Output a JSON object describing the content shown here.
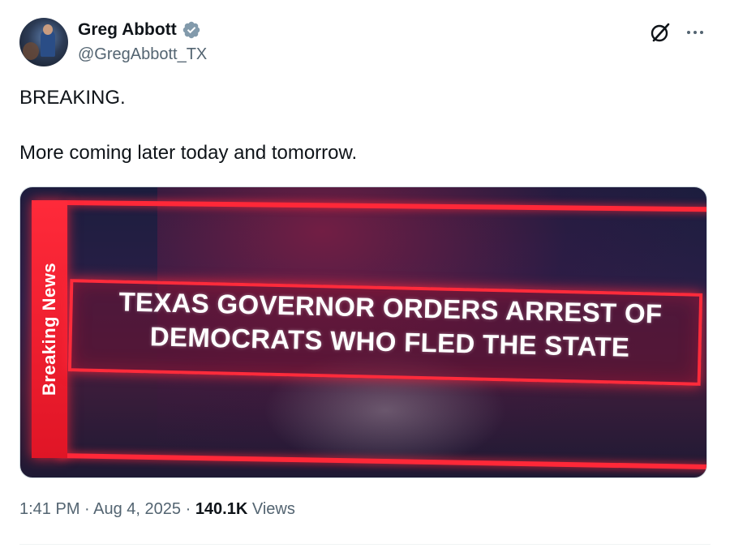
{
  "author": {
    "name": "Greg Abbott",
    "handle": "@GregAbbott_TX",
    "avatar_icon": "profile-photo",
    "verified_icon": "verified-badge-icon",
    "verified_color": "#829aab"
  },
  "header_actions": {
    "grok_icon": "grok-icon",
    "more_icon": "more-options-icon"
  },
  "tweet": {
    "text_line1": "BREAKING.",
    "text_line2": "More coming later today and tomorrow."
  },
  "media": {
    "side_label": "Breaking News",
    "headline_line1": "TEXAS GOVERNOR ORDERS ARREST OF",
    "headline_line2": "DEMOCRATS WHO FLED THE STATE",
    "accent_color": "#ff2838"
  },
  "meta": {
    "time": "1:41 PM",
    "separator1": " · ",
    "date": "Aug 4, 2025",
    "separator2": " · ",
    "views_count": "140.1K",
    "views_label": " Views"
  }
}
